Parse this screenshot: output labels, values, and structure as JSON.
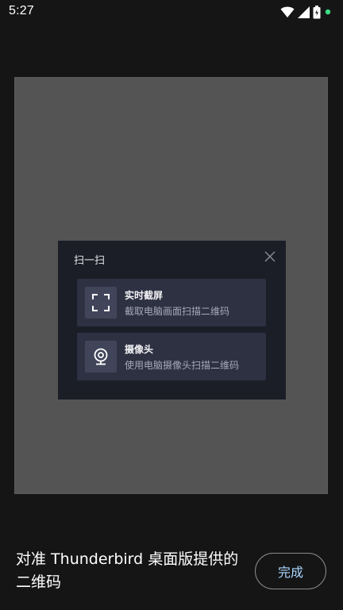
{
  "status_bar": {
    "time": "5:27",
    "icons": [
      "wifi-icon",
      "signal-icon",
      "battery-icon",
      "notification-dot-icon"
    ],
    "dot_color": "#3ddc84"
  },
  "preview": {
    "dialog": {
      "title": "扫一扫",
      "close_icon": "close-icon",
      "options": [
        {
          "icon": "screenshot-frame-icon",
          "title": "实时截屏",
          "description": "截取电脑画面扫描二维码"
        },
        {
          "icon": "webcam-icon",
          "title": "摄像头",
          "description": "使用电脑摄像头扫描二维码"
        }
      ]
    }
  },
  "instruction": {
    "text": "对准 Thunderbird 桌面版提供的二维码"
  },
  "done_button": {
    "label": "完成"
  },
  "colors": {
    "background": "#151515",
    "preview": "#545454",
    "dialog": "#1b1e27",
    "option": "#2e3142",
    "accent": "#a9d6ff"
  }
}
